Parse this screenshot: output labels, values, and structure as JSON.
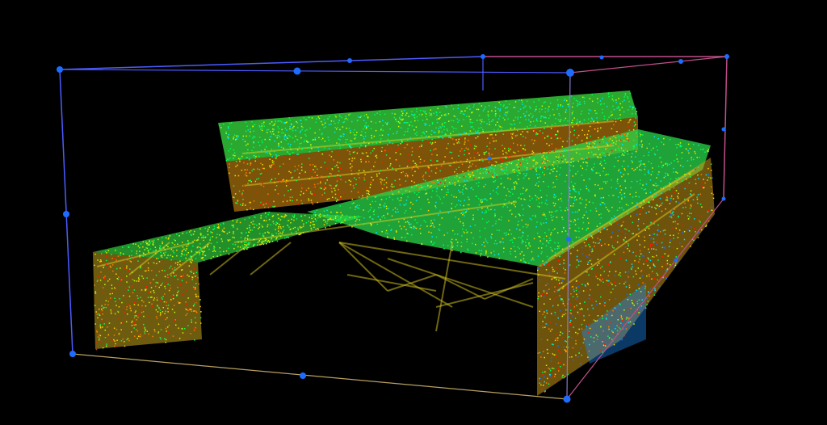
{
  "viewer": {
    "background": "#000000",
    "bbox_colors": {
      "edge_blue": "#4d5bff",
      "edge_pink": "#c0508a",
      "edge_gold": "#b8a060",
      "handle_blue": "#1e6cff"
    },
    "colormap": [
      "#1a6bff",
      "#00e5ff",
      "#00ff55",
      "#c8ff00",
      "#ffd000",
      "#ff7a00",
      "#ff1a00"
    ]
  }
}
